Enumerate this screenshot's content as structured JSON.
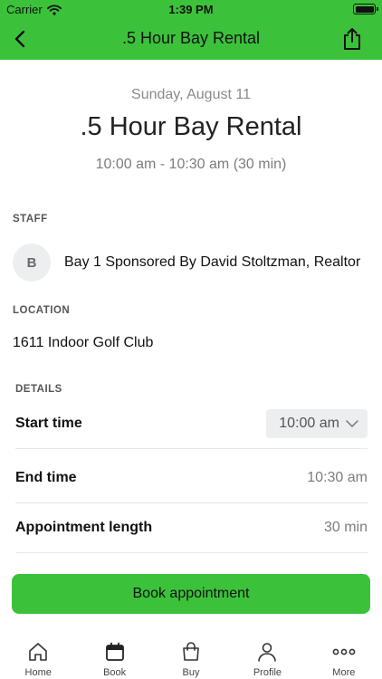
{
  "status_bar": {
    "carrier": "Carrier",
    "time": "1:39 PM"
  },
  "nav": {
    "title": ".5 Hour Bay Rental",
    "back_icon": "chevron-left-icon",
    "share_icon": "share-icon"
  },
  "appointment": {
    "date": "Sunday, August 11",
    "service": ".5 Hour Bay Rental",
    "time_range": "10:00 am - 10:30 am (30 min)"
  },
  "staff": {
    "label": "STAFF",
    "avatar_initial": "B",
    "name": "Bay 1 Sponsored By David Stoltzman, Realtor"
  },
  "location": {
    "label": "LOCATION",
    "name": "1611 Indoor Golf Club"
  },
  "details": {
    "label": "DETAILS",
    "start_label": "Start time",
    "start_value": "10:00 am",
    "end_label": "End time",
    "end_value": "10:30 am",
    "length_label": "Appointment length",
    "length_value": "30 min"
  },
  "book_button": {
    "label": "Book appointment"
  },
  "tabs": [
    {
      "label": "Home",
      "icon": "home-icon"
    },
    {
      "label": "Book",
      "icon": "calendar-icon"
    },
    {
      "label": "Buy",
      "icon": "shopping-bag-icon"
    },
    {
      "label": "Profile",
      "icon": "person-icon"
    },
    {
      "label": "More",
      "icon": "more-icon"
    }
  ],
  "colors": {
    "accent": "#3cc13b",
    "muted_text": "#7c7c7c",
    "chip_bg": "#eceef0"
  }
}
